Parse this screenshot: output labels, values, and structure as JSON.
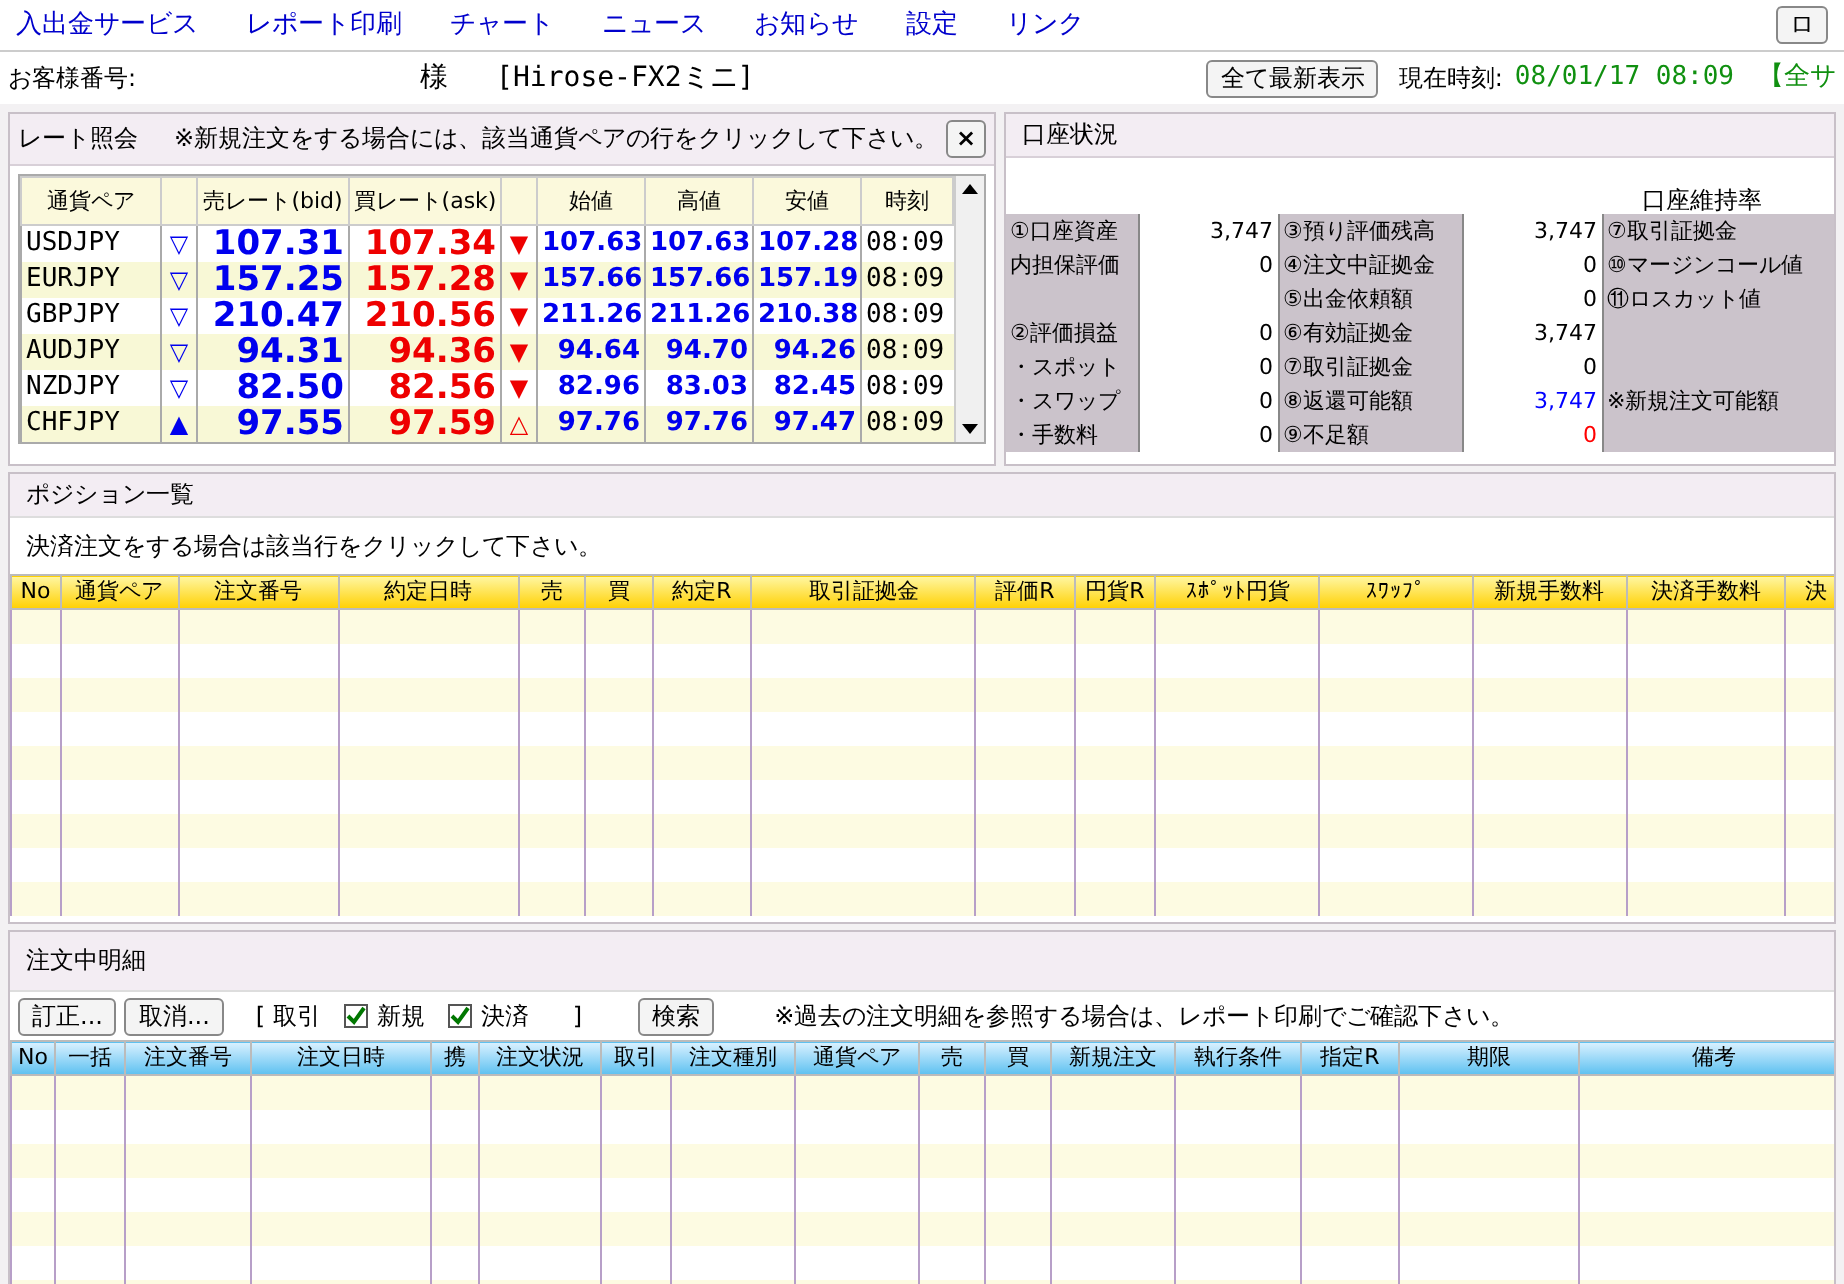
{
  "menu": [
    "入出金サービス",
    "レポート印刷",
    "チャート",
    "ニュース",
    "お知らせ",
    "設定",
    "リンク"
  ],
  "menu_right_button": "ロ",
  "info": {
    "customer_label": "お客様番号:",
    "honorific": "様",
    "product": "[Hirose-FX2ミニ]",
    "refresh_button": "全て最新表示",
    "time_label": "現在時刻:",
    "time": "08/01/17 08:09",
    "notice": "【全サ"
  },
  "rates": {
    "title": "レート照会",
    "note": "※新規注文をする場合には、該当通貨ペアの行をクリックして下さい。",
    "close": "×",
    "columns": [
      "通貨ペア",
      "売レート(bid)",
      "買レート(ask)",
      "始値",
      "高値",
      "安値",
      "時刻"
    ],
    "rows": [
      {
        "pair": "USDJPY",
        "bid_mark": "▽",
        "bid": "107.31",
        "ask": "107.34",
        "ask_mark": "▼",
        "open": "107.63",
        "high": "107.63",
        "low": "107.28",
        "time": "08:09"
      },
      {
        "pair": "EURJPY",
        "bid_mark": "▽",
        "bid": "157.25",
        "ask": "157.28",
        "ask_mark": "▼",
        "open": "157.66",
        "high": "157.66",
        "low": "157.19",
        "time": "08:09"
      },
      {
        "pair": "GBPJPY",
        "bid_mark": "▽",
        "bid": "210.47",
        "ask": "210.56",
        "ask_mark": "▼",
        "open": "211.26",
        "high": "211.26",
        "low": "210.38",
        "time": "08:09"
      },
      {
        "pair": "AUDJPY",
        "bid_mark": "▽",
        "bid": "94.31",
        "ask": "94.36",
        "ask_mark": "▼",
        "open": "94.64",
        "high": "94.70",
        "low": "94.26",
        "time": "08:09"
      },
      {
        "pair": "NZDJPY",
        "bid_mark": "▽",
        "bid": "82.50",
        "ask": "82.56",
        "ask_mark": "▼",
        "open": "82.96",
        "high": "83.03",
        "low": "82.45",
        "time": "08:09"
      },
      {
        "pair": "CHFJPY",
        "bid_mark": "▲",
        "bid": "97.55",
        "ask": "97.59",
        "ask_mark": "△",
        "open": "97.76",
        "high": "97.76",
        "low": "97.47",
        "time": "08:09"
      }
    ]
  },
  "account": {
    "title": "口座状況",
    "ratio_label": "口座維持率",
    "rows": [
      {
        "label1": "①口座資産",
        "value1": "3,747",
        "label2": "③預り評価残高",
        "value2": "3,747",
        "label3": "⑦取引証拠金"
      },
      {
        "label1": "内担保評価",
        "value1": "0",
        "label2": "④注文中証拠金",
        "value2": "0",
        "label3": "⑩マージンコール値"
      },
      {
        "label2": "⑤出金依頼額",
        "value2": "0",
        "label3": "⑪ロスカット値"
      },
      {
        "label1": "②評価損益",
        "value1": "0",
        "label2": "⑥有効証拠金",
        "value2": "3,747"
      },
      {
        "label1": "・スポット",
        "value1": "0",
        "label2": "⑦取引証拠金",
        "value2": "0"
      },
      {
        "label1": "・スワップ",
        "value1": "0",
        "label2": "⑧返還可能額",
        "value2": {
          "text": "3,747",
          "color": "#0000ff"
        },
        "label3": "※新規注文可能額"
      },
      {
        "label1": "・手数料",
        "value1": "0",
        "label2": "⑨不足額",
        "value2": {
          "text": "0",
          "color": "#ff0000"
        }
      }
    ]
  },
  "positions": {
    "title": "ポジション一覧",
    "note": "決済注文をする場合は該当行をクリックして下さい。",
    "columns": [
      "No",
      "通貨ペア",
      "注文番号",
      "約定日時",
      "売",
      "買",
      "約定R",
      "取引証拠金",
      "評価R",
      "円貨R",
      "ｽﾎﾟｯﾄ円貨",
      "ｽﾜｯﾌﾟ",
      "新規手数料",
      "決済手数料",
      "決"
    ]
  },
  "orders": {
    "title": "注文中明細",
    "buttons": [
      "訂正...",
      "取消..."
    ],
    "filter_open": "[ 取引",
    "filters": [
      {
        "label": "新規",
        "checked": true
      },
      {
        "label": "決済",
        "checked": true
      }
    ],
    "filter_close": "]",
    "search_button": "検索",
    "note": "※過去の注文明細を参照する場合は、レポート印刷でご確認下さい。",
    "columns": [
      "No",
      "一括",
      "注文番号",
      "注文日時",
      "携",
      "注文状況",
      "取引",
      "注文種別",
      "通貨ペア",
      "売",
      "買",
      "新規注文",
      "執行条件",
      "指定R",
      "期限",
      "備考"
    ]
  }
}
